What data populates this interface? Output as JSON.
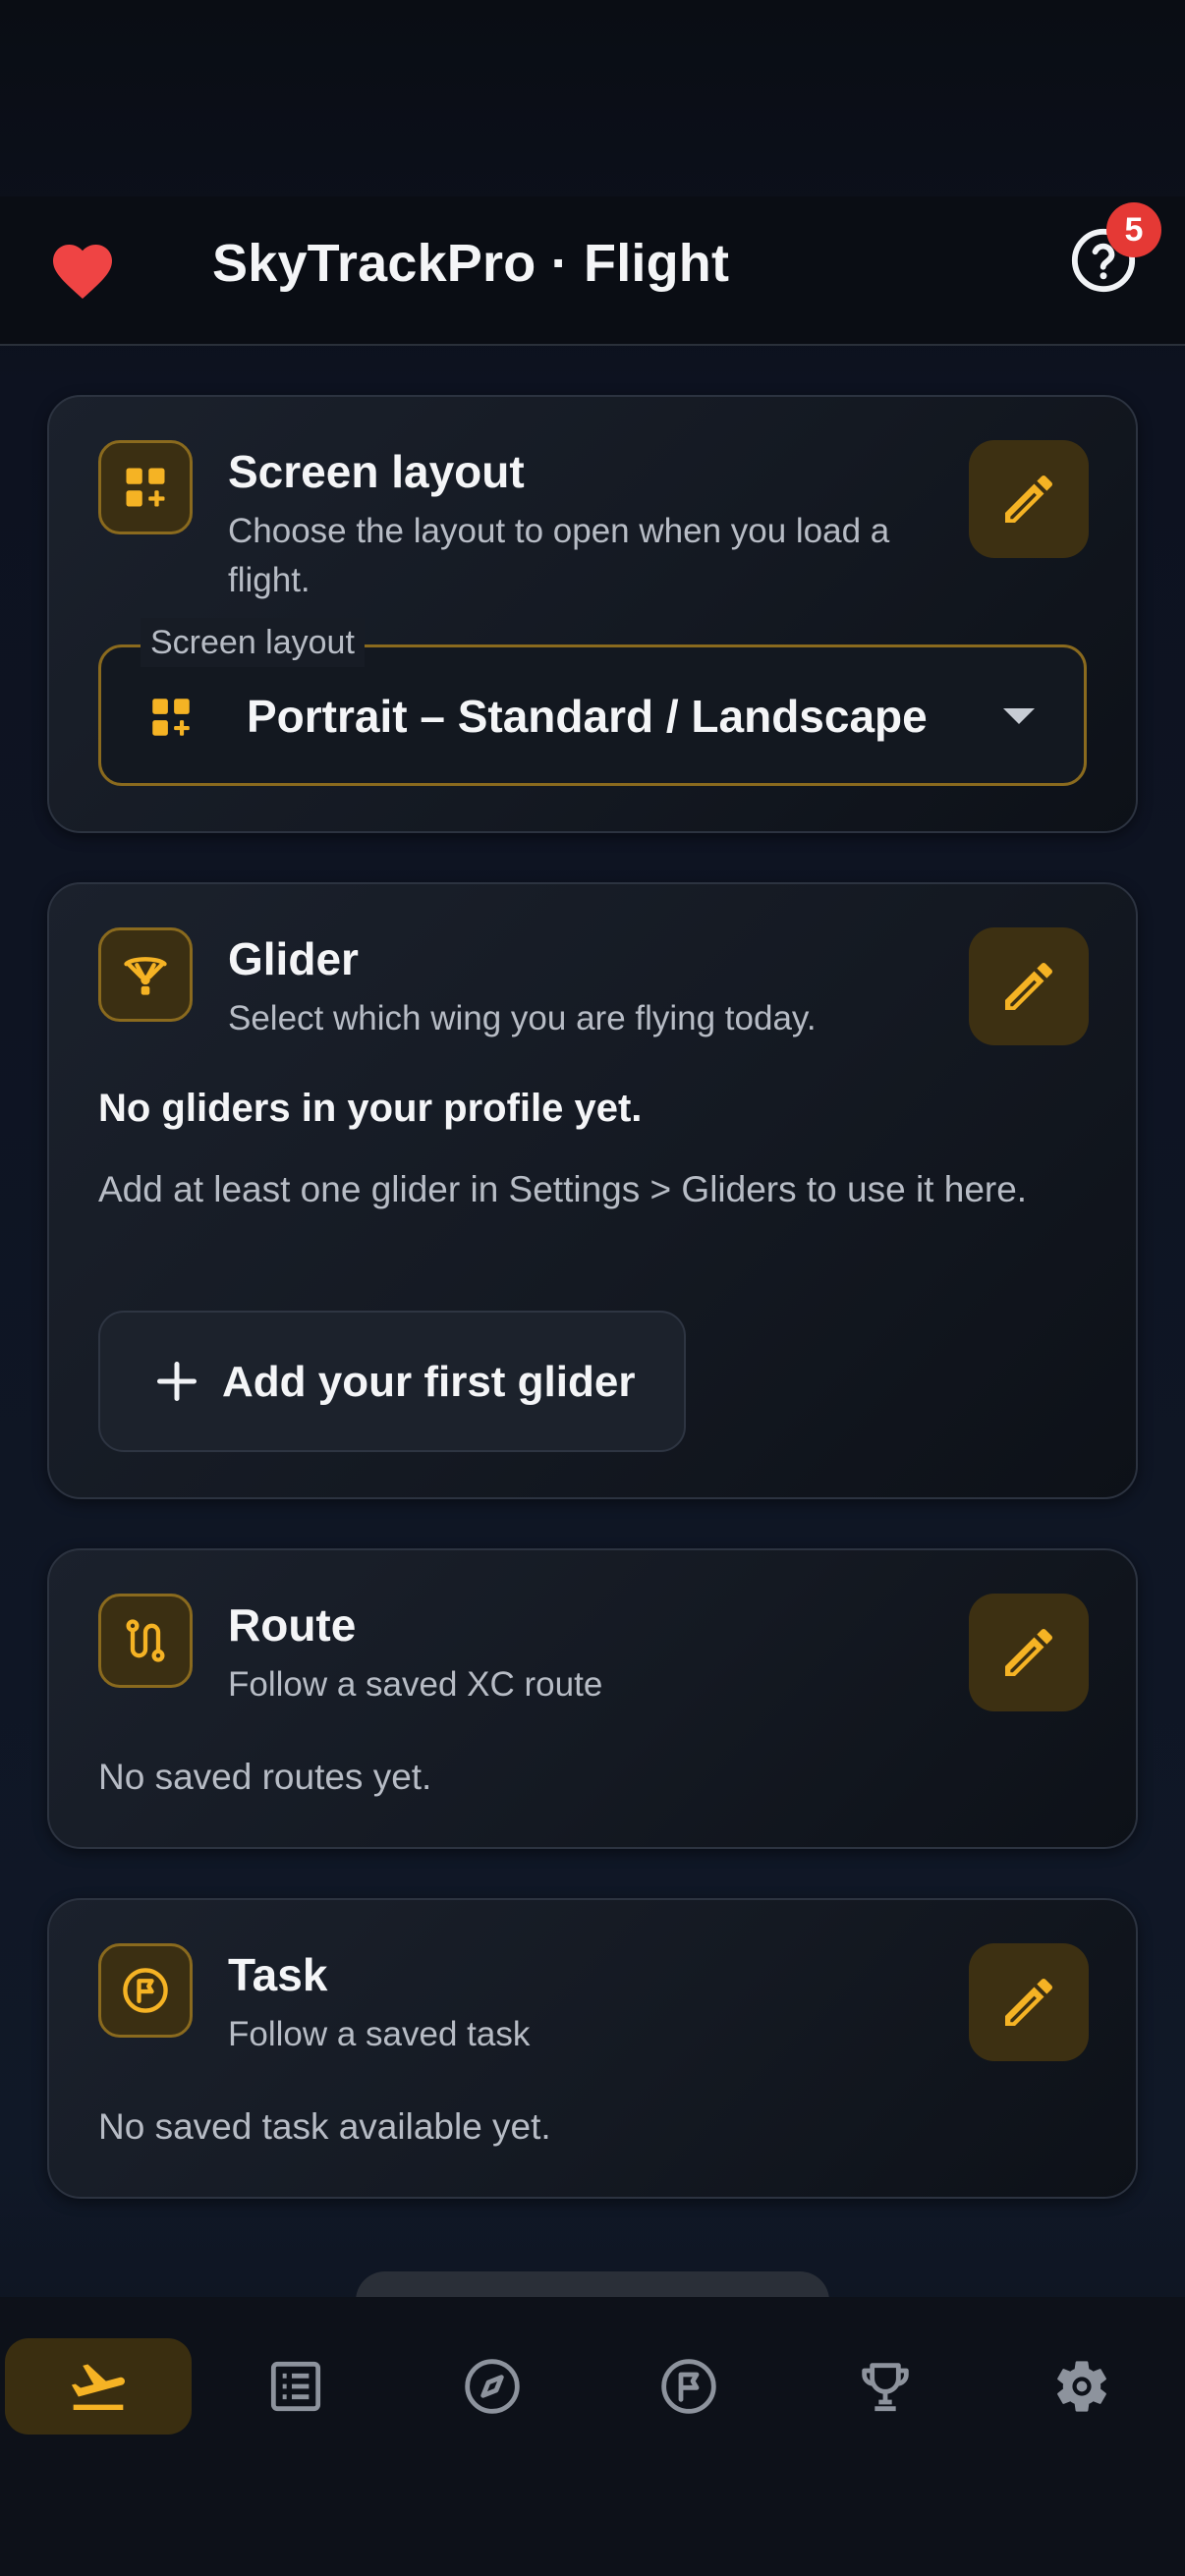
{
  "header": {
    "title": "SkyTrackPro · Flight",
    "help_badge": "5"
  },
  "cards": {
    "layout": {
      "title": "Screen layout",
      "subtitle": "Choose the layout to open when you load a flight.",
      "select_label": "Screen layout",
      "select_value": "Portrait – Standard / Landscape"
    },
    "glider": {
      "title": "Glider",
      "subtitle": "Select which wing you are flying today.",
      "empty_title": "No gliders in your profile yet.",
      "empty_text": "Add at least one glider in Settings > Gliders to use it here.",
      "add_button": "Add your first glider"
    },
    "route": {
      "title": "Route",
      "subtitle": "Follow a saved XC route",
      "empty_text": "No saved routes yet."
    },
    "task": {
      "title": "Task",
      "subtitle": "Follow a saved task",
      "empty_text": "No saved task available yet."
    }
  },
  "nav": {
    "items": [
      "takeoff-icon",
      "logbook-icon",
      "compass-icon",
      "task-flag-icon",
      "trophy-icon",
      "gear-icon"
    ],
    "active": 0
  },
  "colors": {
    "accent": "#f5b324",
    "badge": "#e53935",
    "heart": "#ef4444"
  }
}
